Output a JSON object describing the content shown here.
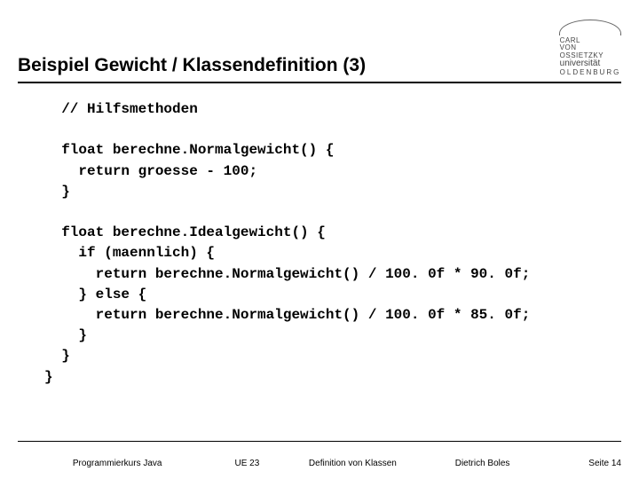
{
  "header": {
    "title": "Beispiel Gewicht / Klassendefinition (3)",
    "logo": {
      "line1": "CARL",
      "line2": "VON",
      "line3": "OSSIETZKY",
      "uni": "universität",
      "city": "OLDENBURG"
    }
  },
  "code": {
    "lines": [
      "  // Hilfsmethoden",
      "",
      "  float berechne.Normalgewicht() {",
      "    return groesse - 100;",
      "  }",
      "",
      "  float berechne.Idealgewicht() {",
      "    if (maennlich) {",
      "      return berechne.Normalgewicht() / 100. 0f * 90. 0f;",
      "    } else {",
      "      return berechne.Normalgewicht() / 100. 0f * 85. 0f;",
      "    }",
      "  }",
      "}"
    ]
  },
  "footer": {
    "course": "Programmierkurs Java",
    "unit": "UE 23",
    "topic": "Definition von Klassen",
    "author": "Dietrich Boles",
    "page": "Seite 14"
  }
}
